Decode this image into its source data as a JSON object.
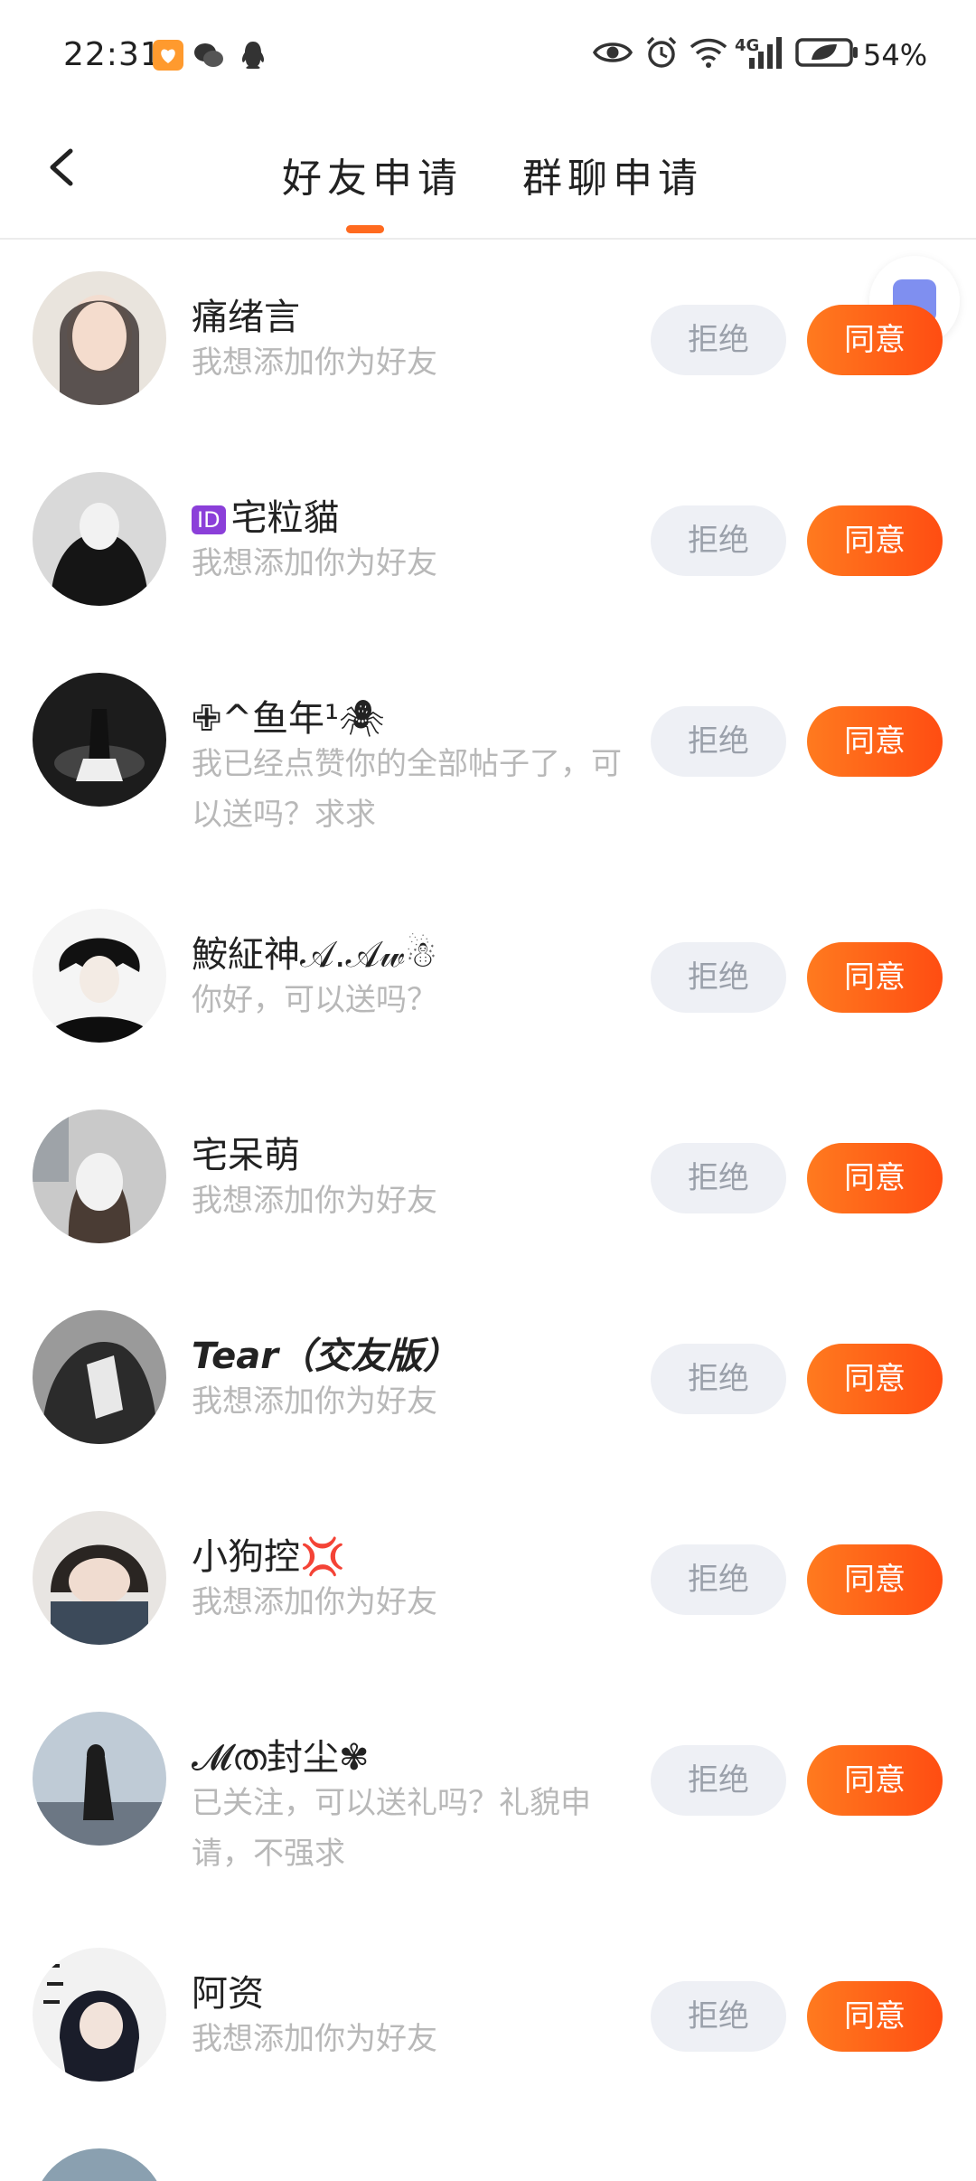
{
  "status_bar": {
    "time": "22:31",
    "battery": "54%",
    "network": "4G"
  },
  "header": {
    "tabs": [
      {
        "label": "好友申请",
        "active": true
      },
      {
        "label": "群聊申请",
        "active": false
      }
    ]
  },
  "buttons": {
    "reject": "拒绝",
    "accept": "同意"
  },
  "requests": [
    {
      "name": "痛绪言",
      "message": "我想添加你为好友"
    },
    {
      "name": "宅粒貓",
      "badge": "ID",
      "message": "我想添加你为好友"
    },
    {
      "name": "✙^鱼年¹🕷",
      "message": "我已经点赞你的全部帖子了，可以送吗？求求"
    },
    {
      "name": "鮟䋊神𝒜.𝒜𝓌☃",
      "message": "你好，可以送吗？"
    },
    {
      "name": "宅呆萌",
      "message": "我想添加你为好友"
    },
    {
      "name": "Tear（交友版）",
      "message": "我想添加你为好友"
    },
    {
      "name": "小狗控💢",
      "message": "我想添加你为好友"
    },
    {
      "name": "𝓜ത封尘✾",
      "message": "已关注，可以送礼吗？礼貌申请，不强求"
    },
    {
      "name": "阿资",
      "message": "我想添加你为好友"
    }
  ],
  "colors": {
    "accent": "#ff5f1a",
    "reject_bg": "#eef0f5",
    "message_text": "#b8b8b8"
  }
}
